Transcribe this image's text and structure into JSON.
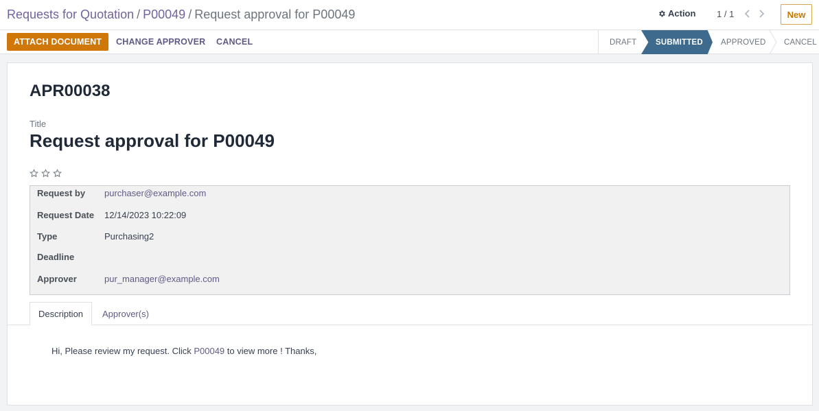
{
  "breadcrumb": {
    "items": [
      "Requests for Quotation",
      "P00049"
    ],
    "separator": "/",
    "current": "Request approval for P00049"
  },
  "header": {
    "action_label": "Action",
    "action_icon": "gear-icon",
    "pager": "1 / 1",
    "new_label": "New"
  },
  "buttons": {
    "attach": "ATTACH DOCUMENT",
    "change_approver": "CHANGE APPROVER",
    "cancel": "CANCEL"
  },
  "stages": [
    {
      "label": "DRAFT",
      "active": false
    },
    {
      "label": "SUBMITTED",
      "active": true
    },
    {
      "label": "APPROVED",
      "active": false
    },
    {
      "label": "CANCEL",
      "active": false
    }
  ],
  "record": {
    "reference": "APR00038",
    "title_label": "Title",
    "title": "Request approval for P00049",
    "priority_stars": 3,
    "priority_value": 0
  },
  "fields": [
    {
      "label": "Request by",
      "value": "purchaser@example.com",
      "link": true
    },
    {
      "label": "Request Date",
      "value": "12/14/2023 10:22:09",
      "link": false
    },
    {
      "label": "Type",
      "value": "Purchasing2",
      "link": false
    },
    {
      "label": "Deadline",
      "value": "",
      "link": false
    },
    {
      "label": "Approver",
      "value": "pur_manager@example.com",
      "link": true
    }
  ],
  "tabs": [
    {
      "label": "Description",
      "active": true
    },
    {
      "label": "Approver(s)",
      "active": false
    }
  ],
  "description": {
    "before": "Hi, Please review my request. Click ",
    "link": "P00049",
    "after": " to view more ! Thanks,"
  },
  "colors": {
    "accent_brand": "#71639e",
    "primary_button": "#d0770a",
    "active_stage": "#3e6a8e"
  }
}
